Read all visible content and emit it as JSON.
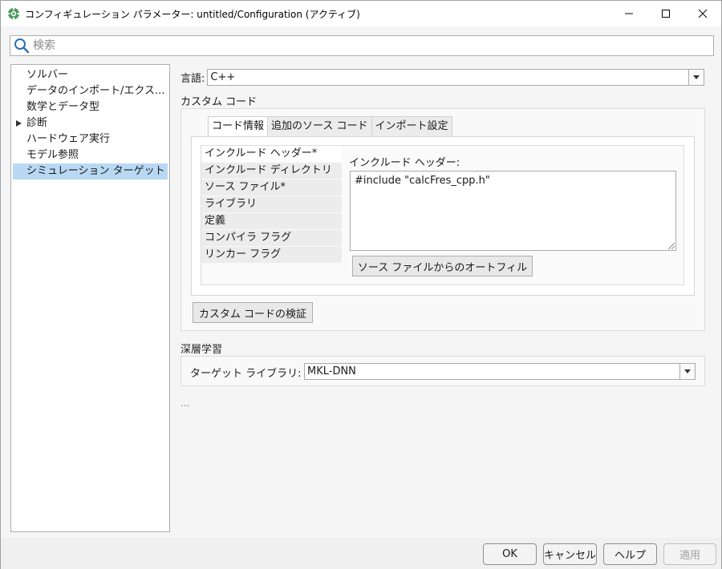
{
  "window": {
    "title": "コンフィギュレーション パラメーター: untitled/Configuration (アクティブ)"
  },
  "search": {
    "placeholder": "検索",
    "value": ""
  },
  "tree": {
    "items": [
      {
        "label": "ソルバー"
      },
      {
        "label": "データのインポート/エクス..."
      },
      {
        "label": "数学とデータ型"
      },
      {
        "label": "診断"
      },
      {
        "label": "ハードウェア実行"
      },
      {
        "label": "モデル参照"
      },
      {
        "label": "シミュレーション ターゲット"
      }
    ]
  },
  "language": {
    "label": "言語:",
    "value": "C++"
  },
  "custom_code": {
    "title": "カスタム コード",
    "tabs": [
      {
        "label": "コード情報"
      },
      {
        "label": "追加のソース コード"
      },
      {
        "label": "インポート設定"
      }
    ],
    "list": [
      {
        "label": "インクルード ヘッダー*"
      },
      {
        "label": "インクルード ディレクトリ"
      },
      {
        "label": "ソース ファイル*"
      },
      {
        "label": "ライブラリ"
      },
      {
        "label": "定義"
      },
      {
        "label": "コンパイラ フラグ"
      },
      {
        "label": "リンカー フラグ"
      }
    ],
    "header_label": "インクルード ヘッダー:",
    "header_value": "#include \"calcFres_cpp.h\"",
    "autofill_button": "ソース ファイルからのオートフィル",
    "validate_button": "カスタム コードの検証"
  },
  "deep_learning": {
    "title": "深層学習",
    "target_label": "ターゲット ライブラリ:",
    "target_value": "MKL-DNN"
  },
  "more": "...",
  "footer": {
    "ok": "OK",
    "cancel": "キャンセル",
    "help": "ヘルプ",
    "apply": "適用"
  },
  "colors": {
    "selection": "#b8d8f3",
    "border": "#aeaeae"
  }
}
